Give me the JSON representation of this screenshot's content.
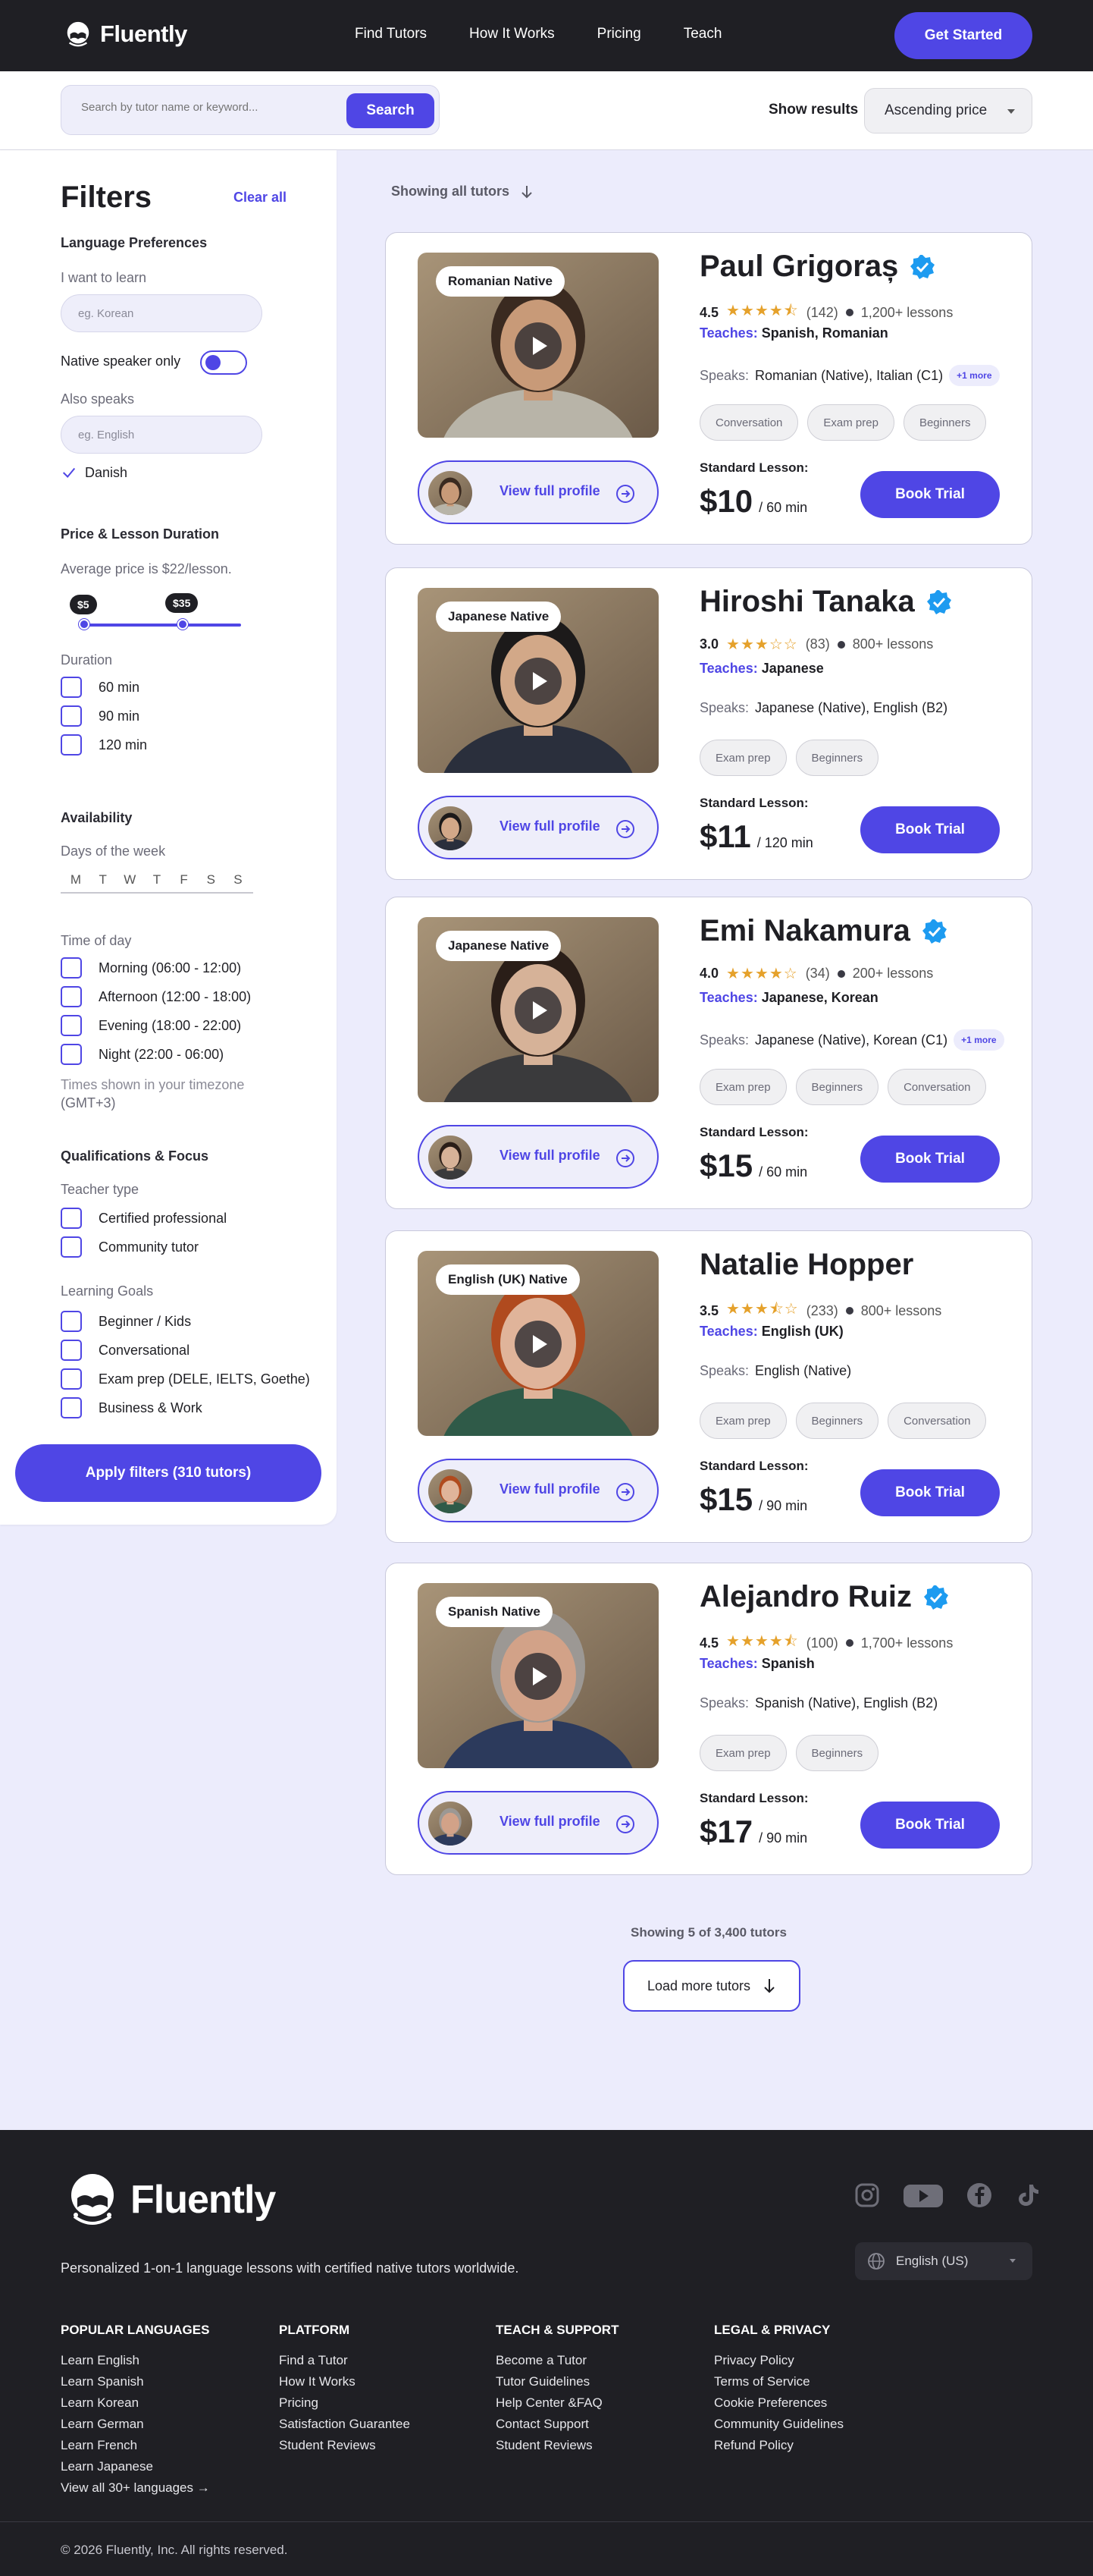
{
  "nav": {
    "brand": "Fluently",
    "links": [
      "Find Tutors",
      "How It Works",
      "Pricing",
      "Teach"
    ],
    "cta": "Get Started"
  },
  "search": {
    "placeholder": "Search by tutor name or keyword...",
    "button": "Search",
    "show_results_label": "Show results",
    "sort_value": "Ascending price"
  },
  "filters": {
    "title": "Filters",
    "clear_all": "Clear all",
    "language": {
      "heading": "Language Preferences",
      "learn_label": "I want to learn",
      "learn_placeholder": "eg. Korean",
      "native_only_label": "Native speaker only",
      "native_only_on": true,
      "also_speaks_label": "Also speaks",
      "also_speaks_placeholder": "eg. English",
      "selected_language": "Danish"
    },
    "price": {
      "heading": "Price & Lesson Duration",
      "average": "Average price is $22/lesson.",
      "min_label": "$5",
      "max_label": "$35",
      "duration_label": "Duration",
      "durations": [
        "60 min",
        "90 min",
        "120 min"
      ]
    },
    "availability": {
      "heading": "Availability",
      "days_label": "Days of the week",
      "days": [
        "M",
        "T",
        "W",
        "T",
        "F",
        "S",
        "S"
      ],
      "time_label": "Time of day",
      "times": [
        "Morning (06:00 - 12:00)",
        "Afternoon (12:00 - 18:00)",
        "Evening (18:00 - 22:00)",
        "Night (22:00 - 06:00)"
      ],
      "timezone_note": "Times shown in your timezone",
      "timezone": "(GMT+3)"
    },
    "qualifications": {
      "heading": "Qualifications & Focus",
      "teacher_type_label": "Teacher type",
      "teacher_types": [
        "Certified professional",
        "Community tutor"
      ],
      "goals_label": "Learning Goals",
      "goals": [
        "Beginner / Kids",
        "Conversational",
        "Exam prep (DELE, IELTS, Goethe)",
        "Business & Work"
      ]
    },
    "apply": "Apply filters (310 tutors)"
  },
  "results": {
    "showing_all": "Showing all tutors",
    "view_profile": "View full profile",
    "book_trial": "Book Trial",
    "standard_lesson": "Standard Lesson:",
    "teaches_label": "Teaches:",
    "speaks_label": "Speaks:",
    "tutors": [
      {
        "native": "Romanian Native",
        "name": "Paul Grigoraș",
        "verified": true,
        "rating": "4.5",
        "stars": 4.5,
        "reviews": "(142)",
        "lessons": "1,200+ lessons",
        "teaches": "Spanish, Romanian",
        "speaks": "Romanian (Native), Italian (C1)",
        "more": "+1 more",
        "tags": [
          "Conversation",
          "Exam prep",
          "Beginners"
        ],
        "price": "$10",
        "duration": "/ 60 min"
      },
      {
        "native": "Japanese Native",
        "name": "Hiroshi Tanaka",
        "verified": true,
        "rating": "3.0",
        "stars": 3,
        "reviews": "(83)",
        "lessons": "800+ lessons",
        "teaches": "Japanese",
        "speaks": "Japanese (Native), English (B2)",
        "more": "",
        "tags": [
          "Exam prep",
          "Beginners"
        ],
        "price": "$11",
        "duration": "/ 120 min"
      },
      {
        "native": "Japanese Native",
        "name": "Emi Nakamura",
        "verified": true,
        "rating": "4.0",
        "stars": 4,
        "reviews": "(34)",
        "lessons": "200+ lessons",
        "teaches": "Japanese, Korean",
        "speaks": "Japanese (Native), Korean (C1)",
        "more": "+1 more",
        "tags": [
          "Exam prep",
          "Beginners",
          "Conversation"
        ],
        "price": "$15",
        "duration": "/ 60 min"
      },
      {
        "native": "English (UK) Native",
        "name": "Natalie Hopper",
        "verified": false,
        "rating": "3.5",
        "stars": 3.5,
        "reviews": "(233)",
        "lessons": "800+ lessons",
        "teaches": "English (UK)",
        "speaks": "English (Native)",
        "more": "",
        "tags": [
          "Exam prep",
          "Beginners",
          "Conversation"
        ],
        "price": "$15",
        "duration": "/ 90 min"
      },
      {
        "native": "Spanish Native",
        "name": "Alejandro Ruiz",
        "verified": true,
        "rating": "4.5",
        "stars": 4.5,
        "reviews": "(100)",
        "lessons": "1,700+ lessons",
        "teaches": "Spanish",
        "speaks": "Spanish (Native), English (B2)",
        "more": "",
        "tags": [
          "Exam prep",
          "Beginners"
        ],
        "price": "$17",
        "duration": "/ 90 min"
      }
    ],
    "count_text": "Showing 5 of 3,400 tutors",
    "load_more": "Load more tutors"
  },
  "footer": {
    "brand": "Fluently",
    "tagline": "Personalized 1-on-1 language lessons with certified native tutors worldwide.",
    "language_picker": "English (US)",
    "social_icons": [
      "instagram-icon",
      "youtube-icon",
      "facebook-icon",
      "tiktok-icon"
    ],
    "columns": [
      {
        "heading": "POPULAR LANGUAGES",
        "links": [
          "Learn English",
          "Learn Spanish",
          "Learn Korean",
          "Learn German",
          "Learn French",
          "Learn Japanese",
          "View all 30+ languages →"
        ]
      },
      {
        "heading": "PLATFORM",
        "links": [
          "Find a Tutor",
          "How It Works",
          "Pricing",
          "Satisfaction Guarantee",
          "Student Reviews"
        ]
      },
      {
        "heading": "TEACH & SUPPORT",
        "links": [
          "Become a Tutor",
          "Tutor Guidelines",
          "Help Center &FAQ",
          "Contact Support",
          "Student Reviews"
        ]
      },
      {
        "heading": "LEGAL & PRIVACY",
        "links": [
          "Privacy Policy",
          "Terms of Service",
          "Cookie Preferences",
          "Community Guidelines",
          "Refund Policy"
        ]
      }
    ],
    "copyright": "© 2026 Fluently, Inc. All rights reserved."
  },
  "colors": {
    "accent": "#4f46e5",
    "dark": "#1f1f24",
    "page_bg": "#ececfc",
    "star": "#e5a12b",
    "verified": "#1d9bf0"
  }
}
